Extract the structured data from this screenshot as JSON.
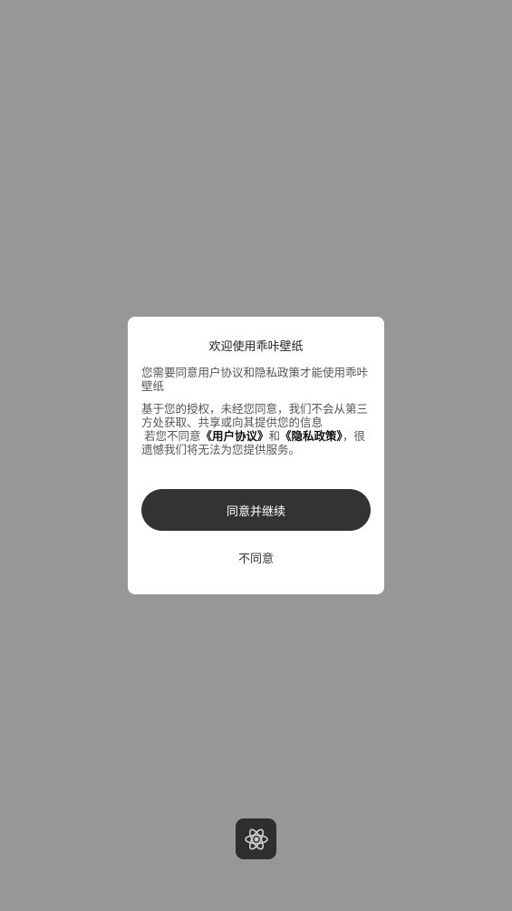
{
  "dialog": {
    "title": "欢迎使用乖咔壁纸",
    "para1": "您需要同意用户协议和隐私政策才能使用乖咔壁纸",
    "para2": "基于您的授权，未经您同意，我们不会从第三方处获取、共享或向其提供您的信息",
    "para3_prefix": "若您不同意",
    "user_agreement_link": "《用户协议》",
    "para3_and": "和",
    "privacy_policy_link": "《隐私政策》",
    "para3_suffix": "，很遗憾我们将无法为您提供服务。",
    "agree_button": "同意并继续",
    "disagree_button": "不同意"
  },
  "launcher": {
    "icon": "atom-icon"
  },
  "colors": {
    "overlay": "#979797",
    "dialog_bg": "#ffffff",
    "primary_button": "#333333",
    "app_icon_bg": "#2f2f2f"
  }
}
